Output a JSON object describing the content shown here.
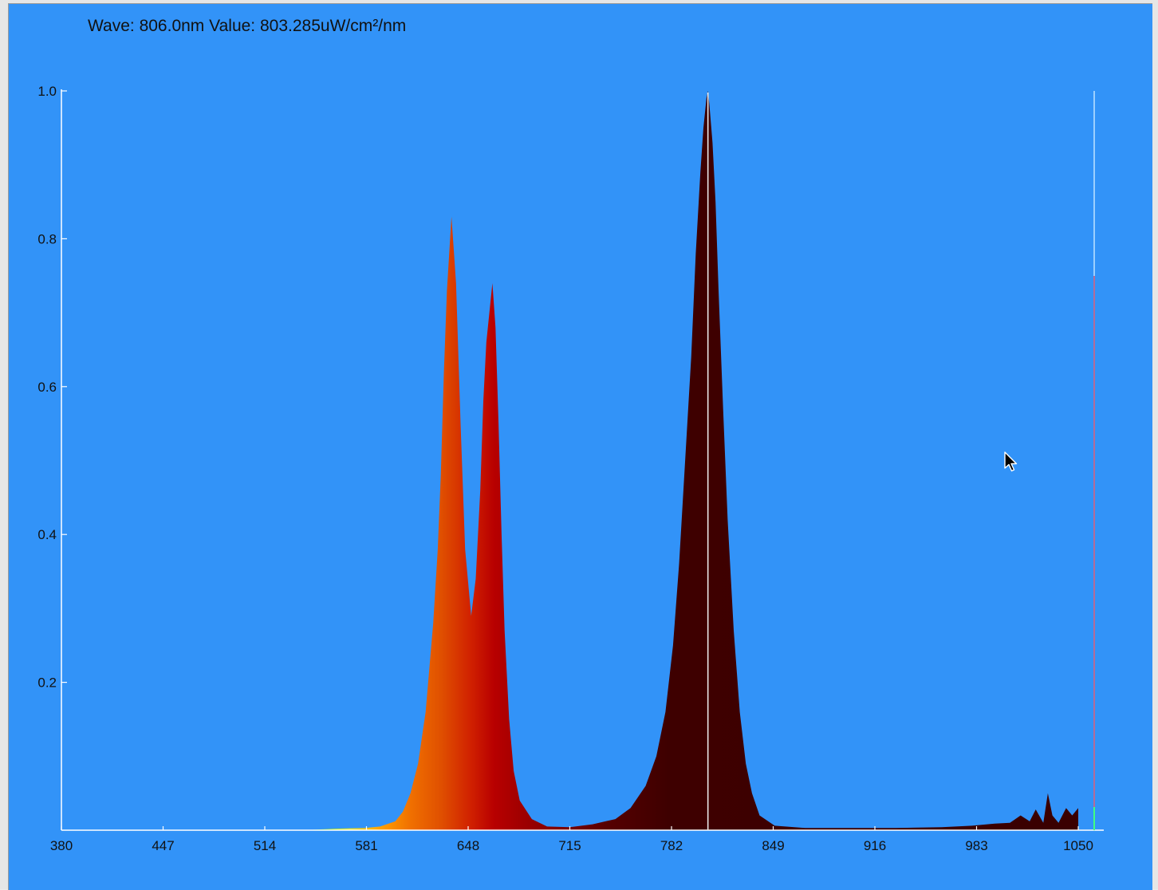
{
  "readout": {
    "wave_label": "Wave:",
    "wave_value": "806.0nm",
    "value_label": "Value:",
    "value_value": "803.285uW/cm²/nm",
    "text": "Wave: 806.0nm  Value: 803.285uW/cm²/nm"
  },
  "chart_data": {
    "type": "area",
    "title": "",
    "xlabel": "",
    "ylabel": "",
    "xlim": [
      380,
      1060
    ],
    "ylim": [
      0,
      1.0
    ],
    "x_ticks": [
      "380",
      "447",
      "514",
      "581",
      "648",
      "715",
      "782",
      "849",
      "916",
      "983",
      "1050"
    ],
    "y_ticks": [
      "0.2",
      "0.4",
      "0.6",
      "0.8",
      "1.0"
    ],
    "grid": false,
    "legend": "none",
    "fill": "wavelength-colored spectrum",
    "cursor_wavelength": 806.0,
    "cursor_value": 803.285,
    "cursor_value_unit": "uW/cm²/nm",
    "series": [
      {
        "x": [
          380,
          500,
          540,
          560,
          580,
          590,
          600,
          605,
          610,
          615,
          620,
          625,
          628,
          630,
          632,
          634,
          637,
          640,
          643,
          646,
          650,
          653,
          656,
          658,
          660,
          662,
          664,
          666,
          668,
          670,
          672,
          675,
          678,
          682,
          690,
          700,
          715,
          730,
          745,
          755,
          765,
          772,
          778,
          783,
          787,
          791,
          795,
          798,
          801,
          803,
          805,
          806,
          807,
          809,
          811,
          813,
          816,
          819,
          823,
          827,
          831,
          835,
          840,
          850,
          870,
          900,
          930,
          960,
          980,
          995,
          1005,
          1012,
          1018,
          1022,
          1027,
          1030,
          1033,
          1037,
          1042,
          1046,
          1050
        ],
        "y": [
          0.0,
          0.0,
          0.0,
          0.002,
          0.003,
          0.005,
          0.012,
          0.025,
          0.05,
          0.09,
          0.16,
          0.28,
          0.38,
          0.48,
          0.62,
          0.73,
          0.83,
          0.74,
          0.55,
          0.38,
          0.29,
          0.34,
          0.46,
          0.58,
          0.66,
          0.7,
          0.74,
          0.68,
          0.55,
          0.4,
          0.27,
          0.15,
          0.08,
          0.04,
          0.015,
          0.005,
          0.004,
          0.008,
          0.015,
          0.03,
          0.06,
          0.1,
          0.16,
          0.25,
          0.36,
          0.5,
          0.64,
          0.78,
          0.89,
          0.95,
          0.99,
          1.0,
          0.98,
          0.93,
          0.85,
          0.73,
          0.57,
          0.42,
          0.27,
          0.16,
          0.09,
          0.05,
          0.02,
          0.006,
          0.003,
          0.003,
          0.003,
          0.004,
          0.006,
          0.009,
          0.01,
          0.02,
          0.012,
          0.028,
          0.01,
          0.05,
          0.02,
          0.01,
          0.03,
          0.02,
          0.03
        ]
      }
    ]
  }
}
